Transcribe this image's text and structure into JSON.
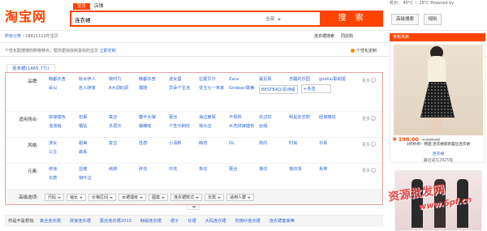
{
  "header": {
    "logo": "淘宝网",
    "tabs": [
      "宝贝",
      "店铺"
    ],
    "search_value": "连衣裙",
    "category": "全部",
    "search_button": "搜 索",
    "top_right": "杭州：  40°C ~ 28°C   Powered by",
    "adv_search": "高级搜索",
    "use_help": "规则"
  },
  "breadcrumb": {
    "all": "所有分类",
    "arrow": "›",
    "count": "18421112件宝贝",
    "right_links": [
      "连衣裙搜索",
      "同店购"
    ]
  },
  "hint": {
    "text": "个性化配搜搜的购物特点，帮你更快找到喜欢的宝贝",
    "link": "立即定制",
    "custom": "个性化定制"
  },
  "keyword_tab": "连衣裙(1465.7万)",
  "filters": [
    {
      "label": "品牌:",
      "values": [
        "韩都衣舍",
        "秋水伊人",
        "致时力",
        "韩都衣舍",
        "波女屋",
        "拉夏贝尔",
        "Zara",
        "蔓尼佩",
        "苏醒的乐园",
        "goelia/歌莉娅",
        "朵以",
        "名人随笔",
        "A大调BJ调",
        "霞隆",
        "异朵个生活",
        "零五七一世家",
        "Girdear/歌蒂",
        "BESTBAO/百诗缇"
      ],
      "more": "更多",
      "multi": "+多选"
    },
    {
      "label": "适用场合:",
      "values": [
        "拼接撞色",
        "包裹",
        "真丝",
        "春半大摆",
        "蕾丝",
        "海边度假",
        "不规则",
        "衣边纹",
        "明星杂志款",
        "经典格纹",
        "泡泡袖",
        "镶钻",
        "多层次",
        "蝴蝶结",
        "个性印刷纹",
        "荷片边",
        "水洗拼接撞色",
        "丝绒"
      ],
      "more": "更多"
    },
    {
      "label": "风格:",
      "values": [
        "淑女",
        "甜美",
        "复古",
        "性感",
        "小清新",
        "韩范",
        "OL",
        "简约",
        "时尚",
        "日系",
        "公主",
        "森系"
      ],
      "more": "更多"
    },
    {
      "label": "元素:",
      "values": [
        "修身",
        "显瘦",
        "纯棉",
        "碎花",
        "印花",
        "条纹",
        "蕾丝",
        "格纹",
        "格纹领",
        "系带",
        "长款",
        "荷叶边"
      ],
      "more": "更多"
    }
  ],
  "advanced": {
    "label": "高级选项:",
    "dropdowns": [
      "尺码",
      "袖长",
      "价格区间",
      "女裙理级",
      "图案",
      "连衣裙款式",
      "长款",
      "适用人群"
    ]
  },
  "related": {
    "label": "你是不是想找:",
    "items": [
      "真丝连衣裙",
      "拼接连衣裙",
      "蕾丝连衣裙2013",
      "韩版连衣裙",
      "裙子",
      "长裙",
      "大码连衣裙",
      "防御纱连衣裙",
      "连衣裙套装等"
    ]
  },
  "sidebar": {
    "header": "掌柜热卖",
    "product": {
      "price": "¥ 198.00",
      "orig": "¥ 198.00",
      "desc": "4折秒杀！韩国 连衣裙新款蕾丝连衣裙",
      "shop": "连衣裙",
      "sold": "最近成交2925笔"
    },
    "watermark1": "资源批发网",
    "watermark2": "www.6pf.cn"
  }
}
